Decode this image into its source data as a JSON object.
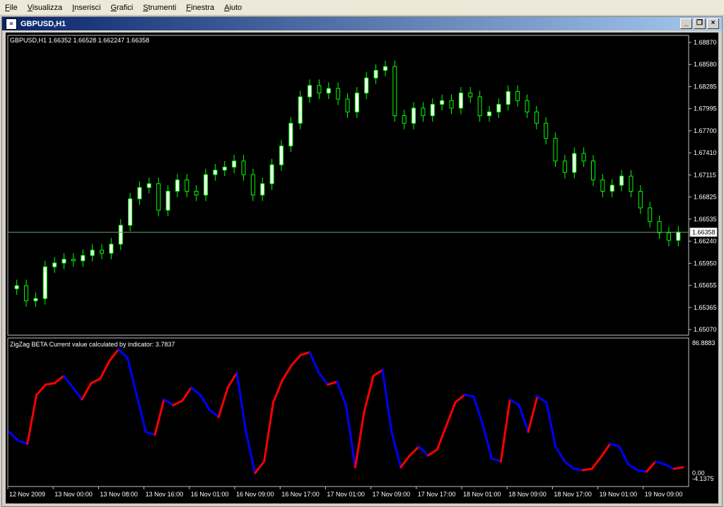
{
  "menu": [
    "File",
    "Visualizza",
    "Inserisci",
    "Grafici",
    "Strumenti",
    "Finestra",
    "Aiuto"
  ],
  "window": {
    "icon": "chart-window-icon",
    "title": "GBPUSD,H1",
    "buttons": [
      "minimize-icon",
      "restore-icon",
      "close-icon"
    ]
  },
  "main_panel": {
    "header": "GBPUSD,H1  1.66352 1.66528 1.662247 1.66358",
    "price_axis": [
      "1.68870",
      "1.68580",
      "1.68285",
      "1.67995",
      "1.67700",
      "1.67410",
      "1.67115",
      "1.66825",
      "1.66535",
      "1.66240",
      "1.65950",
      "1.65655",
      "1.65365",
      "1.65070"
    ],
    "current_price": "1.66358",
    "colors": {
      "bull": "#ffffff",
      "bear": "#000000",
      "wick": "#00ff00",
      "price_line": "#6a9a6a"
    }
  },
  "indicator_panel": {
    "header": "ZigZag BETA    Current value calculated by indicator: 3.7837",
    "axis_top": "86.8883",
    "axis_bottom": "0.00",
    "axis_value": "-4.1375",
    "colors": {
      "up": "#ff0000",
      "down": "#0000ff"
    }
  },
  "time_axis": [
    "12 Nov 2009",
    "13 Nov 00:00",
    "13 Nov 08:00",
    "13 Nov 16:00",
    "16 Nov 01:00",
    "16 Nov 09:00",
    "16 Nov 17:00",
    "17 Nov 01:00",
    "17 Nov 09:00",
    "17 Nov 17:00",
    "18 Nov 01:00",
    "18 Nov 09:00",
    "18 Nov 17:00",
    "19 Nov 01:00",
    "19 Nov 09:00"
  ],
  "chart_data": [
    {
      "type": "candlestick",
      "title": "GBPUSD,H1",
      "ylim": [
        1.6507,
        1.6887
      ],
      "values": [
        1.6565,
        1.6545,
        1.6548,
        1.659,
        1.6595,
        1.66,
        1.6598,
        1.6605,
        1.6612,
        1.6608,
        1.662,
        1.6645,
        1.668,
        1.6695,
        1.67,
        1.6665,
        1.669,
        1.6705,
        1.669,
        1.6685,
        1.6712,
        1.6718,
        1.6722,
        1.673,
        1.6712,
        1.6685,
        1.67,
        1.6725,
        1.675,
        1.678,
        1.6815,
        1.683,
        1.682,
        1.6826,
        1.6812,
        1.6795,
        1.682,
        1.684,
        1.685,
        1.6855,
        1.679,
        1.678,
        1.68,
        1.679,
        1.6805,
        1.681,
        1.68,
        1.682,
        1.6815,
        1.679,
        1.6795,
        1.6805,
        1.6822,
        1.681,
        1.6795,
        1.678,
        1.676,
        1.673,
        1.6715,
        1.674,
        1.673,
        1.6705,
        1.669,
        1.6698,
        1.671,
        1.669,
        1.6668,
        1.665,
        1.6635,
        1.6625,
        1.6636
      ]
    },
    {
      "type": "line",
      "title": "ZigZag BETA",
      "ylim": [
        -4.1375,
        86.8883
      ],
      "values": [
        30,
        24,
        22,
        55,
        62,
        63,
        68,
        60,
        52,
        63,
        66,
        78,
        86,
        80,
        55,
        30,
        28,
        52,
        48,
        51,
        60,
        55,
        45,
        40,
        60,
        70,
        30,
        2,
        10,
        50,
        65,
        75,
        82,
        84,
        70,
        62,
        64,
        48,
        6,
        44,
        68,
        72,
        30,
        6,
        14,
        20,
        14,
        18,
        34,
        50,
        55,
        54,
        35,
        12,
        10,
        52,
        48,
        30,
        54,
        50,
        20,
        10,
        5,
        4,
        5,
        13,
        22,
        20,
        8,
        4,
        3,
        10,
        8,
        5,
        6
      ]
    }
  ]
}
